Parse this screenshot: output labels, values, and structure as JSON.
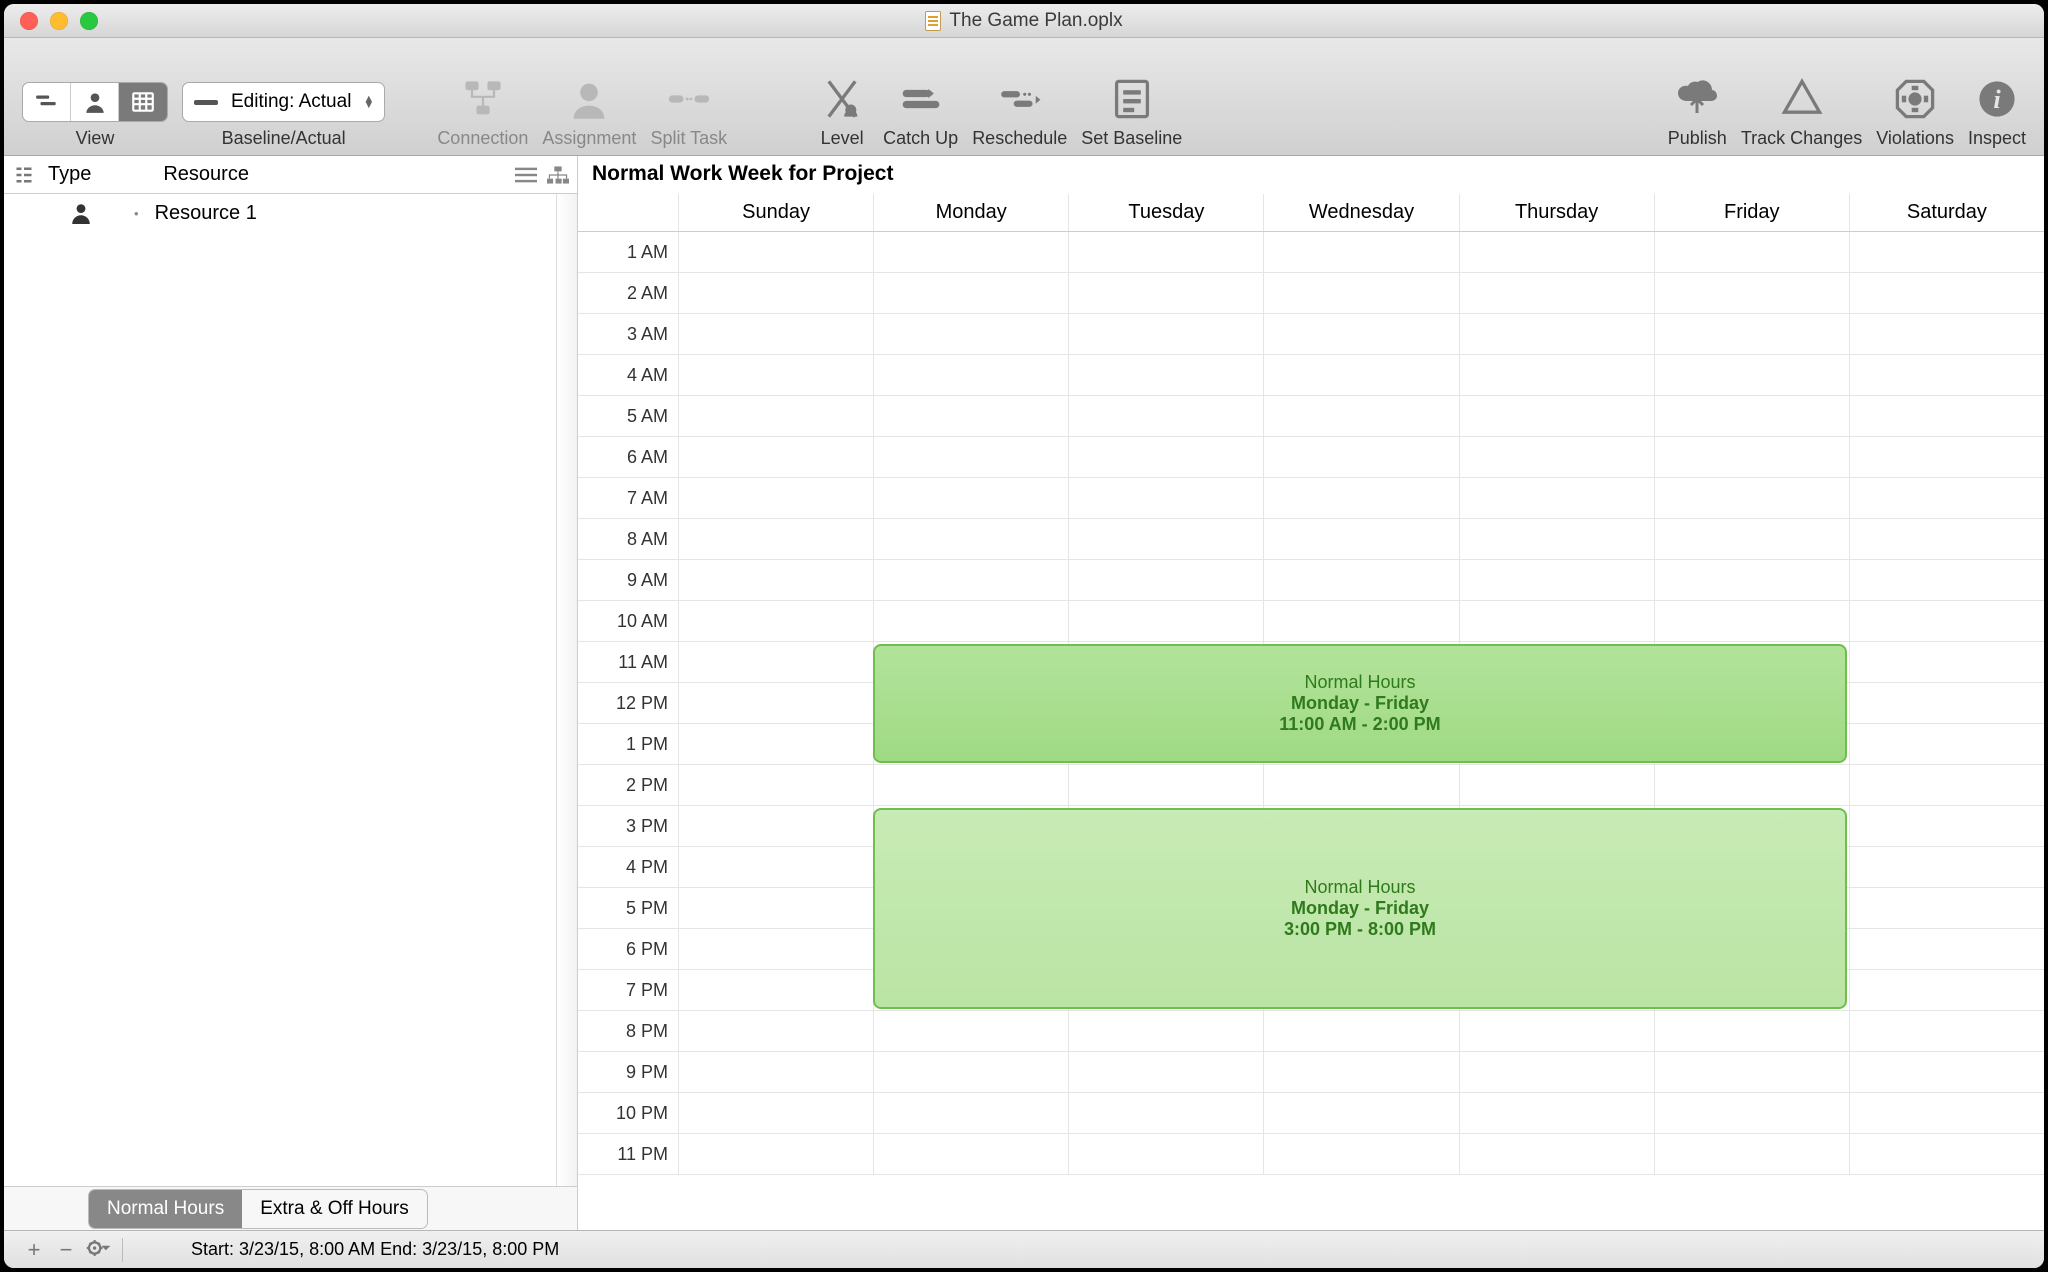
{
  "window": {
    "title": "The Game Plan.oplx"
  },
  "toolbar": {
    "view_label": "View",
    "baseline_actual_label": "Baseline/Actual",
    "dropdown": {
      "icon": "minus",
      "text": "Editing: Actual"
    },
    "connection": "Connection",
    "assignment": "Assignment",
    "split_task": "Split Task",
    "level": "Level",
    "catch_up": "Catch Up",
    "reschedule": "Reschedule",
    "set_baseline": "Set Baseline",
    "publish": "Publish",
    "track_changes": "Track Changes",
    "violations": "Violations",
    "inspect": "Inspect"
  },
  "sidebar": {
    "col_type": "Type",
    "col_resource": "Resource",
    "rows": [
      {
        "name": "Resource 1"
      }
    ],
    "tab_normal": "Normal Hours",
    "tab_extra": "Extra & Off Hours"
  },
  "calendar": {
    "title": "Normal Work Week for Project",
    "days": [
      "Sunday",
      "Monday",
      "Tuesday",
      "Wednesday",
      "Thursday",
      "Friday",
      "Saturday"
    ],
    "hours": [
      "1 AM",
      "2 AM",
      "3 AM",
      "4 AM",
      "5 AM",
      "6 AM",
      "7 AM",
      "8 AM",
      "9 AM",
      "10 AM",
      "11 AM",
      "12 PM",
      "1 PM",
      "2 PM",
      "3 PM",
      "4 PM",
      "5 PM",
      "6 PM",
      "7 PM",
      "8 PM",
      "9 PM",
      "10 PM",
      "11 PM"
    ],
    "events": [
      {
        "title": "Normal Hours",
        "days": "Monday - Friday",
        "time": "11:00 AM - 2:00 PM"
      },
      {
        "title": "Normal Hours",
        "days": "Monday - Friday",
        "time": "3:00 PM - 8:00 PM"
      }
    ]
  },
  "status": {
    "text": "Start: 3/23/15, 8:00 AM End: 3/23/15, 8:00 PM"
  }
}
